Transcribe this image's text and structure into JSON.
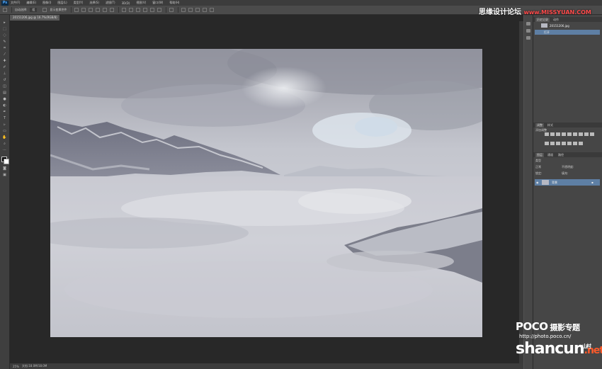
{
  "app": {
    "logo": "Ps",
    "menu": [
      "文件(F)",
      "编辑(E)",
      "图像(I)",
      "图层(L)",
      "类型(Y)",
      "选择(S)",
      "滤镜(T)",
      "3D(D)",
      "视图(V)",
      "窗口(W)",
      "帮助(H)"
    ]
  },
  "options_bar": {
    "auto_select_label": "自动选择:",
    "auto_select_value": "组",
    "show_transform_label": "显示变换控件"
  },
  "document": {
    "tab_title": "20151206.jpg @ 16.7%(RGB/8)"
  },
  "status_bar": {
    "zoom": "25%",
    "doc_info": "文档:18.0M/18.0M"
  },
  "panels": {
    "history": {
      "tabs": [
        "历史记录",
        "动作"
      ],
      "snapshot_label": "20151206.jpg",
      "open_label": "打开"
    },
    "adjustments": {
      "tabs": [
        "调整",
        "样式"
      ],
      "heading": "添加调整"
    },
    "layers": {
      "tabs": [
        "图层",
        "通道",
        "路径"
      ],
      "kind_label": "类型",
      "blend_mode": "正常",
      "opacity_label": "不透明度:",
      "lock_label": "锁定:",
      "fill_label": "填充:",
      "layer_name": "背景"
    }
  },
  "watermarks": {
    "top_right": "思缘设计论坛",
    "top_right_url": "www.MISSYUAN.COM",
    "poco": "POCO",
    "poco_sub": "摄影专题",
    "poco_url": "http://photo.poco.cn/",
    "shancun": "shancun",
    "shancun_cn": "山村",
    "shancun_net": ".net"
  },
  "colors": {
    "accent_selected": "#5e7fa4",
    "workspace": "#282828",
    "panel_bg": "#464646"
  }
}
